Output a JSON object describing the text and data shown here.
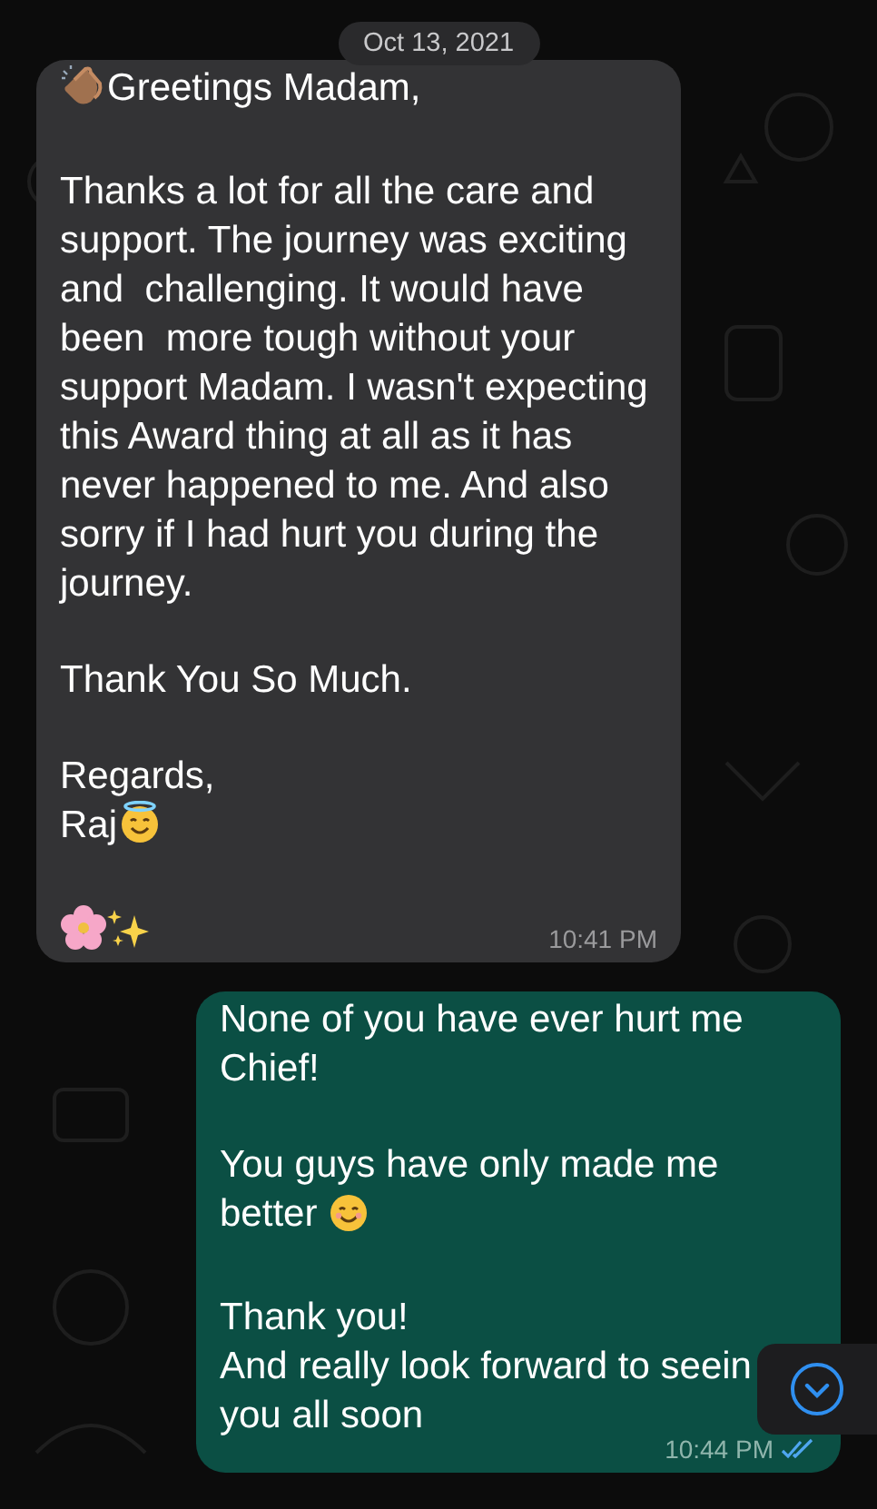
{
  "date_divider": "Oct 13, 2021",
  "messages": [
    {
      "kind": "incoming",
      "paragraphs": [
        [
          [
            {
              "kind": "clap"
            },
            {
              "kind": "text",
              "text": "Greetings Madam,"
            }
          ]
        ],
        [
          [
            {
              "kind": "text",
              "text": "Thanks a lot for all the care and"
            }
          ],
          [
            {
              "kind": "text",
              "text": "support. The journey was exciting"
            }
          ],
          [
            {
              "kind": "text",
              "text": "and  challenging. It would have"
            }
          ],
          [
            {
              "kind": "text",
              "text": "been  more tough without your"
            }
          ],
          [
            {
              "kind": "text",
              "text": "support Madam. I wasn't expecting"
            }
          ],
          [
            {
              "kind": "text",
              "text": "this Award thing at all as it has"
            }
          ],
          [
            {
              "kind": "text",
              "text": "never happened to me. And also"
            }
          ],
          [
            {
              "kind": "text",
              "text": "sorry if I had hurt you during the"
            }
          ],
          [
            {
              "kind": "text",
              "text": "journey."
            }
          ]
        ],
        [
          [
            {
              "kind": "text",
              "text": "Thank You So Much."
            }
          ]
        ],
        [
          [
            {
              "kind": "text",
              "text": "Regards,"
            }
          ],
          [
            {
              "kind": "text",
              "text": "Raj"
            },
            {
              "kind": "angel"
            }
          ]
        ],
        [
          [
            {
              "kind": "flower"
            },
            {
              "kind": "sparkles"
            }
          ]
        ]
      ],
      "time": "10:41 PM",
      "read": false
    },
    {
      "kind": "outgoing",
      "paragraphs": [
        [
          [
            {
              "kind": "text",
              "text": "None of you have ever hurt me"
            }
          ],
          [
            {
              "kind": "text",
              "text": "Chief!"
            }
          ]
        ],
        [
          [
            {
              "kind": "text",
              "text": "You guys have only made me"
            }
          ],
          [
            {
              "kind": "text",
              "text": "better "
            },
            {
              "kind": "smile"
            }
          ]
        ],
        [
          [
            {
              "kind": "text",
              "text": "Thank you!"
            }
          ],
          [
            {
              "kind": "text",
              "text": "And really look forward to seein"
            }
          ],
          [
            {
              "kind": "text",
              "text": "you all soon"
            }
          ]
        ]
      ],
      "time": "10:44 PM",
      "read": true
    }
  ]
}
